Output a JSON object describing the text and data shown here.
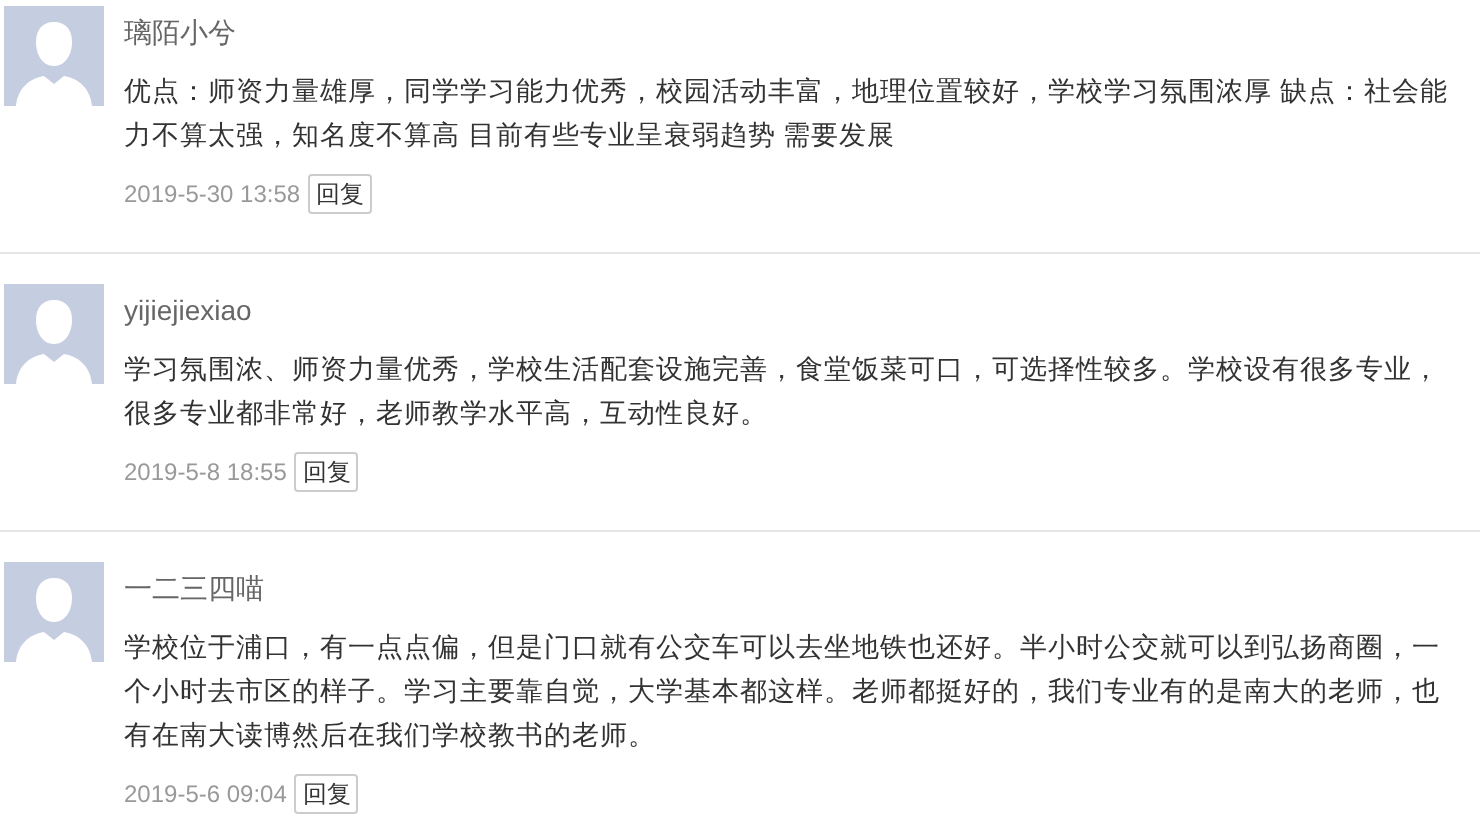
{
  "comments": [
    {
      "author": "璃陌小兮",
      "text": "优点：师资力量雄厚，同学学习能力优秀，校园活动丰富，地理位置较好，学校学习氛围浓厚 缺点：社会能力不算太强，知名度不算高 目前有些专业呈衰弱趋势 需要发展",
      "time": "2019-5-30 13:58",
      "reply": "回复"
    },
    {
      "author": "yijiejiexiao",
      "text": "学习氛围浓、师资力量优秀，学校生活配套设施完善，食堂饭菜可口，可选择性较多。学校设有很多专业，很多专业都非常好，老师教学水平高，互动性良好。",
      "time": "2019-5-8 18:55",
      "reply": "回复"
    },
    {
      "author": "一二三四喵",
      "text": "学校位于浦口，有一点点偏，但是门口就有公交车可以去坐地铁也还好。半小时公交就可以到弘扬商圈，一个小时去市区的样子。学习主要靠自觉，大学基本都这样。老师都挺好的，我们专业有的是南大的老师，也有在南大读博然后在我们学校教书的老师。",
      "time": "2019-5-6 09:04",
      "reply": "回复"
    }
  ]
}
